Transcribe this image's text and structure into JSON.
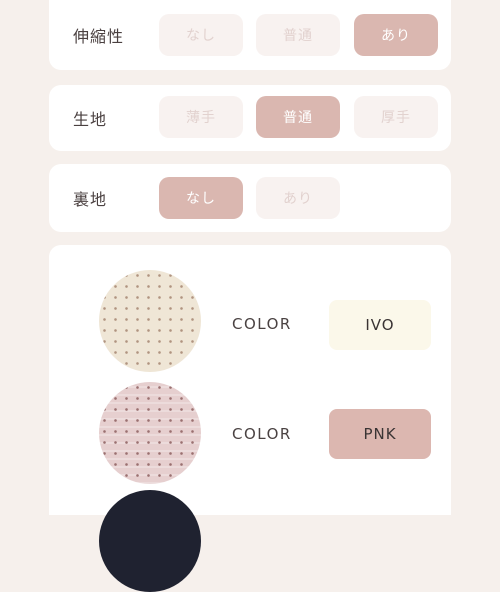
{
  "stretch": {
    "label": "伸縮性",
    "options": [
      {
        "label": "なし",
        "selected": false
      },
      {
        "label": "普通",
        "selected": false
      },
      {
        "label": "あり",
        "selected": true
      }
    ]
  },
  "fabric": {
    "label": "生地",
    "options": [
      {
        "label": "薄手",
        "selected": false
      },
      {
        "label": "普通",
        "selected": true
      },
      {
        "label": "厚手",
        "selected": false
      }
    ]
  },
  "lining": {
    "label": "裏地",
    "options": [
      {
        "label": "なし",
        "selected": true
      },
      {
        "label": "あり",
        "selected": false
      }
    ]
  },
  "colors": [
    {
      "label": "COLOR",
      "code": "IVO",
      "swatch_color": "#efe6d6",
      "box_color": "#fbf8ea"
    },
    {
      "label": "COLOR",
      "code": "PNK",
      "swatch_color": "#e6cfcf",
      "box_color": "#dcb7b0"
    },
    {
      "label": "",
      "code": "",
      "swatch_color": "#1f2230",
      "box_color": ""
    }
  ]
}
